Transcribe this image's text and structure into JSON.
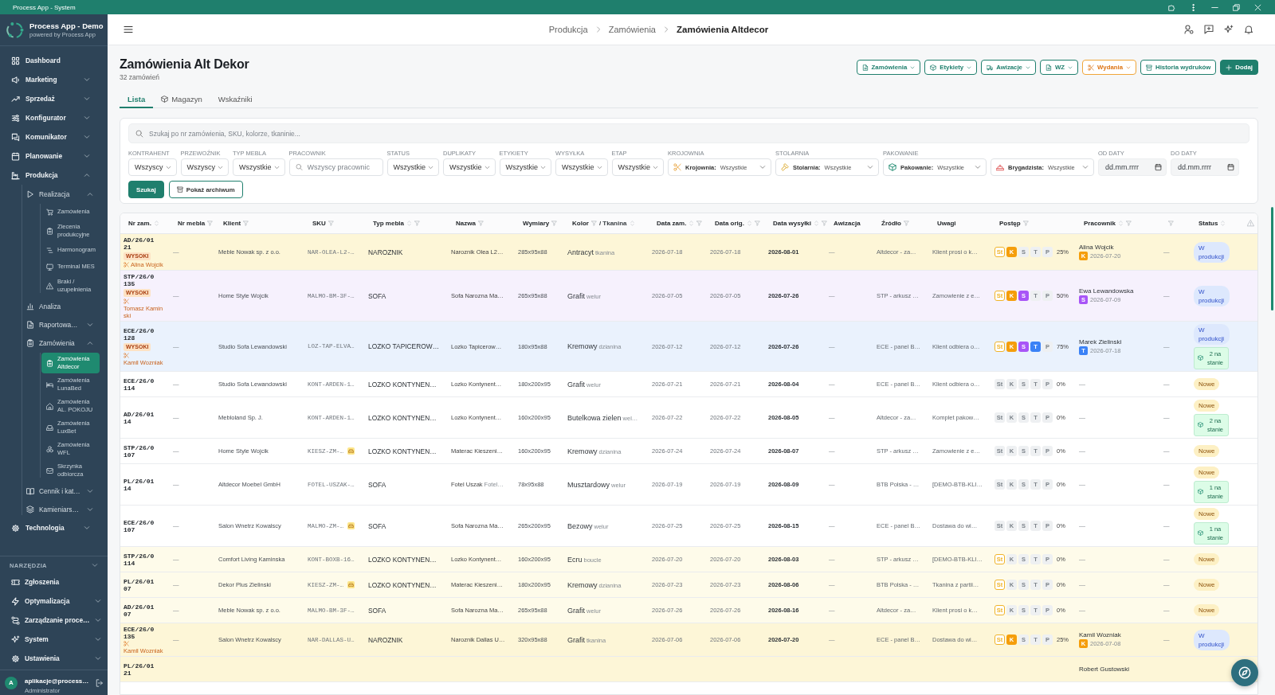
{
  "titlebar": {
    "title": "Process App - System"
  },
  "sidebar": {
    "brand": {
      "name": "Process App - Demo",
      "tagline": "powered by Process App"
    },
    "items": [
      {
        "label": "Dashboard",
        "selected": false
      },
      {
        "label": "Marketing",
        "selected": false,
        "expanded": false
      },
      {
        "label": "Sprzedaż",
        "selected": false,
        "expanded": false
      },
      {
        "label": "Konfigurator",
        "selected": false,
        "expanded": false
      },
      {
        "label": "Komunikator",
        "selected": false,
        "expanded": false
      },
      {
        "label": "Planowanie",
        "selected": false,
        "expanded": false
      },
      {
        "label": "Produkcja",
        "selected": false,
        "expanded": true,
        "children": [
          {
            "label": "Realizacja",
            "selected": false,
            "expanded": true,
            "children": [
              {
                "label": "Zamówienia",
                "selected": false
              },
              {
                "label": "Zlecenia produkcyjne",
                "selected": false
              },
              {
                "label": "Harmonogram",
                "selected": false
              },
              {
                "label": "Terminal MES",
                "selected": false
              },
              {
                "label": "Braki / uzupełnienia",
                "selected": false
              }
            ]
          },
          {
            "label": "Analiza",
            "selected": false
          },
          {
            "label": "Raportowa…",
            "selected": false,
            "expanded": false
          },
          {
            "label": "Zamówienia",
            "selected": false,
            "expanded": true,
            "children": [
              {
                "label": "Zamówienia Altdecor",
                "selected": true
              },
              {
                "label": "Zamówienia LunaBed",
                "selected": false
              },
              {
                "label": "Zamówienia AL. POKOJU",
                "selected": false
              },
              {
                "label": "Zamówienia LuxBet",
                "selected": false
              },
              {
                "label": "Zamówienia WFL",
                "selected": false
              },
              {
                "label": "Skrzynka odbiorcza",
                "selected": false
              }
            ]
          },
          {
            "label": "Cennik i kat…",
            "selected": false,
            "expanded": false
          },
          {
            "label": "Kamieniars…",
            "selected": false,
            "expanded": false
          }
        ]
      },
      {
        "label": "Technologia",
        "selected": false,
        "expanded": false
      }
    ],
    "tools": {
      "label": "NARZĘDZIA",
      "items": [
        {
          "label": "Zgłoszenia",
          "selected": false
        },
        {
          "label": "Optymalizacja",
          "selected": false,
          "expanded": false
        },
        {
          "label": "Zarządzanie proce…",
          "selected": false,
          "expanded": false
        },
        {
          "label": "System",
          "selected": false,
          "expanded": false
        },
        {
          "label": "Ustawienia",
          "selected": false,
          "expanded": false
        }
      ]
    },
    "user": {
      "initial": "A",
      "email": "aplikacje@process…",
      "role": "Administrator"
    }
  },
  "header": {
    "breadcrumb": [
      {
        "label": "Produkcja",
        "current": false
      },
      {
        "label": "Zamówienia",
        "current": false
      },
      {
        "label": "Zamówienia Altdecor",
        "current": true
      }
    ]
  },
  "page": {
    "title": "Zamówienia Alt Dekor",
    "subtitle": "32 zamówień",
    "actions": [
      {
        "label": "Zamówienia",
        "kind": "outline",
        "dropdown": true
      },
      {
        "label": "Etykiety",
        "kind": "outline",
        "dropdown": true
      },
      {
        "label": "Awizacje",
        "kind": "outline",
        "dropdown": true
      },
      {
        "label": "WZ",
        "kind": "outline",
        "dropdown": true
      },
      {
        "label": "Wydania",
        "kind": "warning",
        "dropdown": true
      },
      {
        "label": "Historia wydruków",
        "kind": "outline",
        "dropdown": false
      },
      {
        "label": "Dodaj",
        "kind": "primary",
        "dropdown": false
      }
    ],
    "tabs": [
      {
        "label": "Lista",
        "selected": true
      },
      {
        "label": "Magazyn",
        "selected": false
      },
      {
        "label": "Wskaźniki",
        "selected": false
      }
    ]
  },
  "filters": {
    "search": {
      "placeholder": "Szukaj po nr zamówienia, SKU, kolorze, tkaninie..."
    },
    "fields": [
      {
        "label": "KONTRAHENT",
        "kind": "select",
        "value": "Wszyscy"
      },
      {
        "label": "PRZEWOŹNIK",
        "kind": "select",
        "value": "Wszyscy"
      },
      {
        "label": "TYP MEBLA",
        "kind": "select",
        "value": "Wszystkie"
      },
      {
        "label": "PRACOWNIK",
        "kind": "search",
        "placeholder": "Wszyscy pracownic"
      },
      {
        "label": "STATUS",
        "kind": "select",
        "value": "Wszystkie"
      },
      {
        "label": "DUPLIKATY",
        "kind": "select",
        "value": "Wszystkie"
      },
      {
        "label": "ETYKIETY",
        "kind": "select",
        "value": "Wszystkie"
      },
      {
        "label": "WYSYŁKA",
        "kind": "select",
        "value": "Wszystkie"
      },
      {
        "label": "ETAP",
        "kind": "select",
        "value": "Wszystkie"
      },
      {
        "label": "KROJOWNIA",
        "kind": "stage",
        "prefix": "Krojownia:",
        "value": "Wszystkie"
      },
      {
        "label": "STOLARNIA",
        "kind": "stage",
        "prefix": "Stolarnia:",
        "value": "Wszystkie"
      },
      {
        "label": "PAKOWANIE",
        "kind": "stage",
        "prefix": "Pakowanie:",
        "value": "Wszystkie"
      },
      {
        "kind": "stage",
        "prefix": "Brygadzista:",
        "value": "Wszystkie"
      },
      {
        "label": "OD DATY",
        "kind": "date",
        "placeholder": "dd.mm.rrrr"
      },
      {
        "label": "DO DATY",
        "kind": "date",
        "placeholder": "dd.mm.rrrr"
      }
    ],
    "buttons": [
      {
        "label": "Szukaj",
        "kind": "primary"
      },
      {
        "label": "Pokaż archiwum",
        "kind": "outline"
      }
    ]
  },
  "table": {
    "columns": [
      {
        "label": "Nr zam.",
        "kind": "text",
        "sortable": true,
        "filterable": false
      },
      {
        "label": "Nr mebla",
        "kind": "text",
        "sortable": false,
        "filterable": true
      },
      {
        "label": "Klient",
        "kind": "text",
        "sortable": false,
        "filterable": true
      },
      {
        "label": "SKU",
        "kind": "text",
        "sortable": false,
        "filterable": true
      },
      {
        "label": "Typ mebla",
        "kind": "text",
        "sortable": true,
        "filterable": true
      },
      {
        "label": "Nazwa",
        "kind": "text",
        "sortable": false,
        "filterable": true
      },
      {
        "label": "Wymiary",
        "kind": "text",
        "sortable": false,
        "filterable": true
      },
      {
        "label": "Kolor",
        "sub_label": "/ Tkanina",
        "kind": "text",
        "sortable": true,
        "filterable": true
      },
      {
        "label": "Data zam.",
        "kind": "text",
        "sortable": true,
        "filterable": true
      },
      {
        "label": "Data orig.",
        "kind": "text",
        "sortable": true,
        "filterable": true
      },
      {
        "label": "Data wysyłki",
        "kind": "text",
        "sortable": true,
        "filterable": true
      },
      {
        "label": "Awizacja",
        "kind": "text",
        "sortable": false,
        "filterable": false
      },
      {
        "label": "Źródło",
        "kind": "text",
        "sortable": false,
        "filterable": true
      },
      {
        "label": "Uwagi",
        "kind": "text",
        "sortable": false,
        "filterable": false
      },
      {
        "label": "Postęp",
        "kind": "text",
        "sortable": false,
        "filterable": true
      },
      {
        "label": "Pracownik",
        "kind": "text",
        "sortable": true,
        "filterable": true
      },
      {
        "kind": "text",
        "sortable": false,
        "filterable": true
      },
      {
        "label": "Status",
        "kind": "text",
        "sortable": true,
        "filterable": false
      },
      {
        "kind": "alert",
        "sortable": false,
        "filterable": false
      }
    ],
    "rows": [
      {
        "color": "#fdf6d7",
        "order": "AD/26/0121",
        "priority": "WYSOKI",
        "cutter": "Alina Wojcik",
        "nr_mebla": "—",
        "client": "Meble Nowak sp. z o.o.",
        "sku": "NAR-OLEA-L2-…",
        "sku_flag": false,
        "type": "NAROZNIK",
        "name": "Naroznik Olea L2…",
        "dims": "285x95x88",
        "fabric_color": "Antracyt",
        "fabric": "tkanina",
        "date_order": "2026-07-18",
        "date_orig": "2026-07-18",
        "date_ship": "2026-08-01",
        "advice": "—",
        "source": "Altdecor - za…",
        "notes": "Klient prosi o k…",
        "steps": [
          {
            "label": "St",
            "done": true,
            "kind": "outline",
            "color": "#f0b429"
          },
          {
            "label": "K",
            "done": true,
            "kind": "solid",
            "color": "#f59e0b"
          },
          {
            "label": "S",
            "done": false
          },
          {
            "label": "T",
            "done": false
          },
          {
            "label": "P",
            "done": false
          }
        ],
        "percent": "25%",
        "worker": {
          "name": "Alina Wojcik",
          "assigned": true,
          "stage": "K",
          "color": "#f59e0b",
          "date": "2026-07-20"
        },
        "column_17": "—",
        "status": {
          "label": "W produkcji",
          "kind": "production"
        }
      },
      {
        "color": "#f6f1fd",
        "order": "STP/26/0135",
        "priority": "WYSOKI",
        "cutter": "Tomasz Kaminski",
        "nr_mebla": "—",
        "client": "Home Style Wojcik",
        "sku": "MALMO-BM-3F-…",
        "sku_flag": false,
        "type": "SOFA",
        "name": "Sofa Narozna Ma…",
        "dims": "265x95x88",
        "fabric_color": "Grafit",
        "fabric": "welur",
        "date_order": "2026-07-05",
        "date_orig": "2026-07-05",
        "date_ship": "2026-07-26",
        "advice": "—",
        "source": "STP - arkusz …",
        "notes": "Zamowienie z e…",
        "steps": [
          {
            "label": "St",
            "done": true,
            "kind": "outline",
            "color": "#f0b429"
          },
          {
            "label": "K",
            "done": true,
            "kind": "solid",
            "color": "#f59e0b"
          },
          {
            "label": "S",
            "done": true,
            "kind": "solid",
            "color": "#a855f7"
          },
          {
            "label": "T",
            "done": false
          },
          {
            "label": "P",
            "done": false
          }
        ],
        "percent": "50%",
        "worker": {
          "name": "Ewa Lewandowska",
          "assigned": true,
          "stage": "S",
          "color": "#a855f7",
          "date": "2026-07-09"
        },
        "column_17": "—",
        "status": {
          "label": "W produkcji",
          "kind": "production"
        }
      },
      {
        "color": "#eaf2fd",
        "order": "ECE/26/0128",
        "priority": "WYSOKI",
        "cutter": "Kamil Wozniak",
        "nr_mebla": "—",
        "client": "Studio Sofa Lewandowski",
        "sku": "LOZ-TAP-ELVA…",
        "sku_flag": false,
        "type": "LOZKO TAPICEROW…",
        "name": "Lozko Tapicerow…",
        "dims": "180x95x88",
        "fabric_color": "Kremowy",
        "fabric": "dzianina",
        "date_order": "2026-07-12",
        "date_orig": "2026-07-12",
        "date_ship": "2026-07-26",
        "advice": "—",
        "source": "ECE - panel B…",
        "notes": "Klient odbiera o…",
        "steps": [
          {
            "label": "St",
            "done": true,
            "kind": "outline",
            "color": "#f0b429"
          },
          {
            "label": "K",
            "done": true,
            "kind": "solid",
            "color": "#f59e0b"
          },
          {
            "label": "S",
            "done": true,
            "kind": "solid",
            "color": "#a855f7"
          },
          {
            "label": "T",
            "done": true,
            "kind": "solid",
            "color": "#3b82f6"
          },
          {
            "label": "P",
            "done": false
          }
        ],
        "percent": "75%",
        "worker": {
          "name": "Marek Zielinski",
          "assigned": true,
          "stage": "T",
          "color": "#3b82f6",
          "date": "2026-07-18"
        },
        "column_17": "—",
        "status": {
          "label": "W produkcji",
          "kind": "production"
        },
        "stock": "2 na stanie"
      },
      {
        "color": "#ffffff",
        "order": "ECE/26/0114",
        "nr_mebla": "—",
        "client": "Studio Sofa Lewandowski",
        "sku": "KONT-ARDEN-1…",
        "sku_flag": false,
        "type": "LOZKO KONTYNEN…",
        "name": "Lozko Kontynent…",
        "dims": "180x200x95",
        "fabric_color": "Grafit",
        "fabric": "welur",
        "date_order": "2026-07-21",
        "date_orig": "2026-07-21",
        "date_ship": "2026-08-04",
        "advice": "—",
        "source": "ECE - panel B…",
        "notes": "Klient odbiera o…",
        "steps": [
          {
            "label": "St",
            "done": false
          },
          {
            "label": "K",
            "done": false
          },
          {
            "label": "S",
            "done": false
          },
          {
            "label": "T",
            "done": false
          },
          {
            "label": "P",
            "done": false
          }
        ],
        "percent": "0%",
        "worker": {
          "name": "—",
          "assigned": false
        },
        "column_17": "—",
        "status": {
          "label": "Nowe",
          "kind": "new"
        }
      },
      {
        "color": "#ffffff",
        "order": "AD/26/0114",
        "nr_mebla": "—",
        "client": "Mebloland Sp. J.",
        "sku": "KONT-ARDEN-1…",
        "sku_flag": false,
        "type": "LOZKO KONTYNEN…",
        "name": "Lozko Kontynent…",
        "dims": "160x200x95",
        "fabric_color": "Butelkowa zielen",
        "fabric": "wel…",
        "date_order": "2026-07-22",
        "date_orig": "2026-07-22",
        "date_ship": "2026-08-05",
        "advice": "—",
        "source": "Altdecor - za…",
        "notes": "Komplet pakow…",
        "steps": [
          {
            "label": "St",
            "done": false
          },
          {
            "label": "K",
            "done": false
          },
          {
            "label": "S",
            "done": false
          },
          {
            "label": "T",
            "done": false
          },
          {
            "label": "P",
            "done": false
          }
        ],
        "percent": "0%",
        "worker": {
          "name": "—",
          "assigned": false
        },
        "column_17": "—",
        "status": {
          "label": "Nowe",
          "kind": "new"
        },
        "stock": "2 na stanie"
      },
      {
        "color": "#ffffff",
        "order": "STP/26/0107",
        "nr_mebla": "—",
        "client": "Home Style Wojcik",
        "sku": "KIESZ-ZM-…",
        "sku_flag": true,
        "type": "LOZKO KONTYNEN…",
        "name": "Materac Kieszeni…",
        "dims": "160x200x95",
        "fabric_color": "Kremowy",
        "fabric": "dzianina",
        "date_order": "2026-07-24",
        "date_orig": "2026-07-24",
        "date_ship": "2026-08-07",
        "advice": "—",
        "source": "STP - arkusz …",
        "notes": "Zamowienie z e…",
        "steps": [
          {
            "label": "St",
            "done": false
          },
          {
            "label": "K",
            "done": false
          },
          {
            "label": "S",
            "done": false
          },
          {
            "label": "T",
            "done": false
          },
          {
            "label": "P",
            "done": false
          }
        ],
        "percent": "0%",
        "worker": {
          "name": "—",
          "assigned": false
        },
        "column_17": "—",
        "status": {
          "label": "Nowe",
          "kind": "new"
        }
      },
      {
        "color": "#ffffff",
        "order": "PL/26/0114",
        "nr_mebla": "—",
        "client": "Altdecor Moebel GmbH",
        "sku": "FOTEL-USZAK-…",
        "sku_flag": false,
        "type": "SOFA",
        "name": "Fotel Uszak",
        "name_note": "Fotel…",
        "dims": "78x95x88",
        "fabric_color": "Musztardowy",
        "fabric": "welur",
        "date_order": "2026-07-19",
        "date_orig": "2026-07-19",
        "date_ship": "2026-08-09",
        "advice": "—",
        "source": "BTB Polska - …",
        "notes": "[DEMO-BTB-KLI…",
        "steps": [
          {
            "label": "St",
            "done": false
          },
          {
            "label": "K",
            "done": false
          },
          {
            "label": "S",
            "done": false
          },
          {
            "label": "T",
            "done": false
          },
          {
            "label": "P",
            "done": false
          }
        ],
        "percent": "0%",
        "worker": {
          "name": "—",
          "assigned": false
        },
        "column_17": "—",
        "status": {
          "label": "Nowe",
          "kind": "new"
        },
        "stock": "1 na stanie"
      },
      {
        "color": "#ffffff",
        "order": "ECE/26/0107",
        "nr_mebla": "—",
        "client": "Salon Wnetrz Kowalscy",
        "sku": "MALMO-ZM-…",
        "sku_flag": true,
        "type": "SOFA",
        "name": "Sofa Narozna Ma…",
        "dims": "265x200x95",
        "fabric_color": "Bezowy",
        "fabric": "welur",
        "date_order": "2026-07-25",
        "date_orig": "2026-07-25",
        "date_ship": "2026-08-15",
        "advice": "—",
        "source": "ECE - panel B…",
        "notes": "Dostawa do wi…",
        "steps": [
          {
            "label": "St",
            "done": false
          },
          {
            "label": "K",
            "done": false
          },
          {
            "label": "S",
            "done": false
          },
          {
            "label": "T",
            "done": false
          },
          {
            "label": "P",
            "done": false
          }
        ],
        "percent": "0%",
        "worker": {
          "name": "—",
          "assigned": false
        },
        "column_17": "—",
        "status": {
          "label": "Nowe",
          "kind": "new"
        },
        "stock": "1 na stanie"
      },
      {
        "color": "#fefbea",
        "order": "STP/26/0114",
        "nr_mebla": "—",
        "client": "Comfort Living Kaminska",
        "sku": "KONT-BOXB-16…",
        "sku_flag": false,
        "type": "LOZKO KONTYNEN…",
        "name": "Lozko Kontynent…",
        "dims": "160x200x95",
        "fabric_color": "Ecru",
        "fabric": "boucle",
        "date_order": "2026-07-20",
        "date_orig": "2026-07-20",
        "date_ship": "2026-08-03",
        "advice": "—",
        "source": "STP - arkusz …",
        "notes": "[DEMO-BTB-KLI…",
        "steps": [
          {
            "label": "St",
            "done": true,
            "kind": "outline",
            "color": "#f0b429"
          },
          {
            "label": "K",
            "done": false
          },
          {
            "label": "S",
            "done": false
          },
          {
            "label": "T",
            "done": false
          },
          {
            "label": "P",
            "done": false
          }
        ],
        "percent": "0%",
        "worker": {
          "name": "—",
          "assigned": false
        },
        "column_17": "—",
        "status": {
          "label": "Nowe",
          "kind": "new"
        }
      },
      {
        "color": "#fefbea",
        "order": "PL/26/0107",
        "nr_mebla": "—",
        "client": "Dekor Plus Zielinski",
        "sku": "KIESZ-ZM-…",
        "sku_flag": true,
        "type": "LOZKO KONTYNEN…",
        "name": "Materac Kieszeni…",
        "dims": "180x200x95",
        "fabric_color": "Kremowy",
        "fabric": "dzianina",
        "date_order": "2026-07-23",
        "date_orig": "2026-07-23",
        "date_ship": "2026-08-06",
        "advice": "—",
        "source": "BTB Polska - …",
        "notes": "Tkanina z partii…",
        "steps": [
          {
            "label": "St",
            "done": true,
            "kind": "outline",
            "color": "#f0b429"
          },
          {
            "label": "K",
            "done": false
          },
          {
            "label": "S",
            "done": false
          },
          {
            "label": "T",
            "done": false
          },
          {
            "label": "P",
            "done": false
          }
        ],
        "percent": "0%",
        "worker": {
          "name": "—",
          "assigned": false
        },
        "column_17": "—",
        "status": {
          "label": "Nowe",
          "kind": "new"
        }
      },
      {
        "color": "#fefbea",
        "order": "AD/26/0107",
        "nr_mebla": "—",
        "client": "Meble Nowak sp. z o.o.",
        "sku": "MALMO-BM-3F-…",
        "sku_flag": false,
        "type": "SOFA",
        "name": "Sofa Narozna Ma…",
        "dims": "265x95x88",
        "fabric_color": "Grafit",
        "fabric": "welur",
        "date_order": "2026-07-26",
        "date_orig": "2026-07-26",
        "date_ship": "2026-08-16",
        "advice": "—",
        "source": "Altdecor - za…",
        "notes": "Klient prosi o k…",
        "steps": [
          {
            "label": "St",
            "done": true,
            "kind": "outline",
            "color": "#f0b429"
          },
          {
            "label": "K",
            "done": false
          },
          {
            "label": "S",
            "done": false
          },
          {
            "label": "T",
            "done": false
          },
          {
            "label": "P",
            "done": false
          }
        ],
        "percent": "0%",
        "worker": {
          "name": "—",
          "assigned": false
        },
        "column_17": "—",
        "status": {
          "label": "Nowe",
          "kind": "new"
        }
      },
      {
        "color": "#fdf6d7",
        "order": "ECE/26/0135",
        "cutter": "Kamil Wozniak",
        "nr_mebla": "—",
        "client": "Salon Wnetrz Kowalscy",
        "sku": "NAR-DALLAS-U…",
        "sku_flag": false,
        "type": "NAROZNIK",
        "name": "Naroznik Dallas U…",
        "dims": "320x95x88",
        "fabric_color": "Grafit",
        "fabric": "tkanina",
        "date_order": "2026-07-06",
        "date_orig": "2026-07-06",
        "date_ship": "2026-07-20",
        "advice": "—",
        "source": "ECE - panel B…",
        "notes": "Dostawa do wi…",
        "steps": [
          {
            "label": "St",
            "done": true,
            "kind": "outline",
            "color": "#f0b429"
          },
          {
            "label": "K",
            "done": true,
            "kind": "solid",
            "color": "#f59e0b"
          },
          {
            "label": "S",
            "done": false
          },
          {
            "label": "T",
            "done": false
          },
          {
            "label": "P",
            "done": false
          }
        ],
        "percent": "25%",
        "worker": {
          "name": "Kamil Wozniak",
          "assigned": true,
          "stage": "K",
          "color": "#f59e0b",
          "date": "2026-07-08"
        },
        "column_17": "—",
        "status": {
          "label": "W produkcji",
          "kind": "production"
        }
      },
      {
        "color": "#fdf6d7",
        "order": "PL/26/0121",
        "worker": {
          "name": "Robert Gustowski",
          "assigned": true
        }
      }
    ]
  }
}
